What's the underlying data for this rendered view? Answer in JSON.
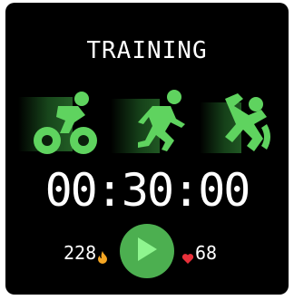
{
  "screen": {
    "title": "TRAINING",
    "timer": "00:30:00"
  },
  "sports": [
    {
      "icon": "cycling-icon"
    },
    {
      "icon": "running-icon"
    },
    {
      "icon": "swimming-icon"
    }
  ],
  "stats": {
    "calories": "228",
    "calories_icon": "flame-icon",
    "heart_rate": "68",
    "heart_icon": "heart-icon"
  },
  "controls": {
    "play_icon": "play-icon"
  },
  "colors": {
    "background": "#000000",
    "accent": "#4caf50",
    "accent_bright": "#5fd35f",
    "flame": "#f5a623",
    "heart": "#e8303a",
    "text": "#ffffff"
  }
}
